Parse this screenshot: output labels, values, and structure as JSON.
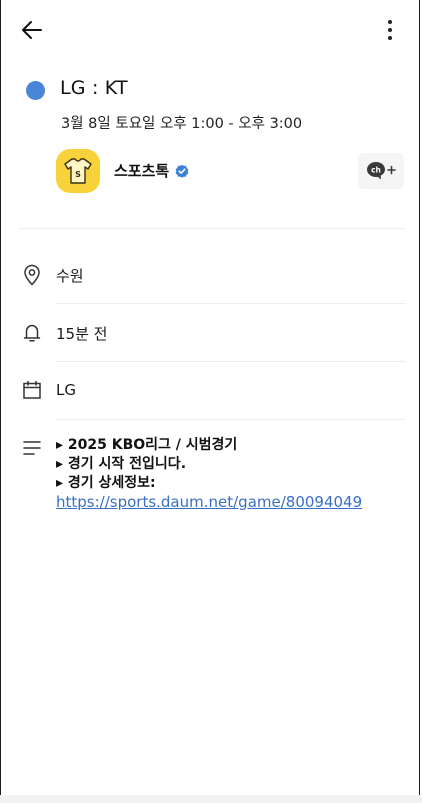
{
  "header": {
    "back_icon": "arrow-left-icon",
    "more_icon": "more-vertical-icon"
  },
  "event": {
    "title": "LG : KT",
    "datetime": "3월 8일 토요일  오후 1:00 - 오후 3:00",
    "color": "#4a86d8"
  },
  "channel": {
    "name": "스포츠톡",
    "logo_color": "#f8d23a",
    "logo_letter": "S",
    "verified_color": "#3b82d6",
    "chat_icon": "channel-chat-add-icon"
  },
  "details": {
    "location": "수원",
    "reminder": "15분 전",
    "calendar": "LG"
  },
  "memo": {
    "line1": "▸ 2025 KBO리그 / 시범경기",
    "line2": "▸ 경기 시작 전입니다.",
    "line3": "▸ 경기 상세정보:",
    "link": "https://sports.daum.net/game/80094049"
  }
}
